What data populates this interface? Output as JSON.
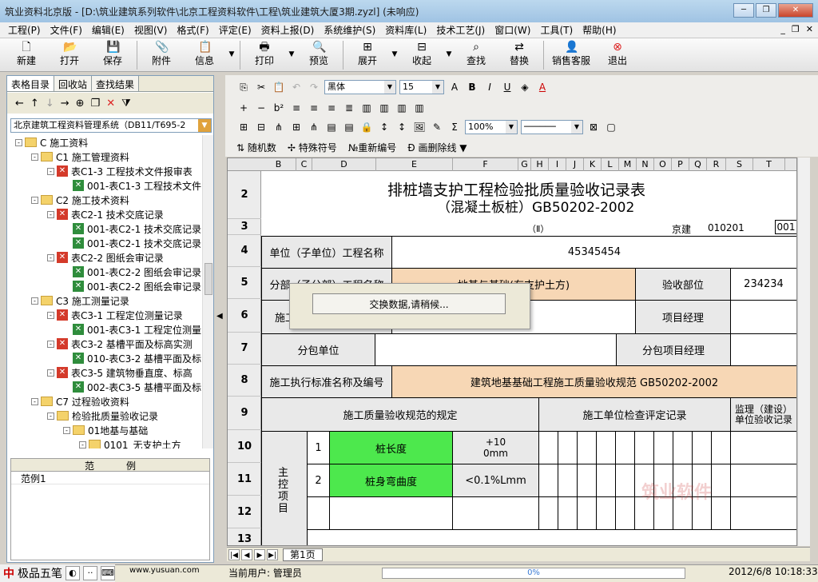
{
  "window": {
    "title": "筑业资料北京版 - [D:\\筑业建筑系列软件\\北京工程资料软件\\工程\\筑业建筑大厦3期.zyzl] (未响应)",
    "minimize": "─",
    "restore": "❐",
    "close": "✕"
  },
  "menu": [
    "工程(P)",
    "文件(F)",
    "编辑(E)",
    "视图(V)",
    "格式(F)",
    "评定(E)",
    "资料上报(D)",
    "系统维护(S)",
    "资料库(L)",
    "技术工艺(J)",
    "窗口(W)",
    "工具(T)",
    "帮助(H)"
  ],
  "menu_right": [
    "_",
    "❐",
    "✕"
  ],
  "toolbar": [
    "新建",
    "打开",
    "保存",
    "附件",
    "信息",
    "打印",
    "预览",
    "展开",
    "收起",
    "查找",
    "替换",
    "销售客服",
    "退出"
  ],
  "left": {
    "tabs": [
      "表格目录",
      "回收站",
      "查找结果"
    ],
    "system_combo": "北京建筑工程资料管理系统（DB11/T695-2",
    "tree": [
      {
        "level": 0,
        "icon": "folder",
        "toggle": "-",
        "label": "C 施工资料"
      },
      {
        "level": 1,
        "icon": "folder",
        "toggle": "-",
        "label": "C1 施工管理资料"
      },
      {
        "level": 2,
        "icon": "redx",
        "toggle": "-",
        "label": "表C1-3 工程技术文件报审表"
      },
      {
        "level": 3,
        "icon": "grnx",
        "toggle": "",
        "label": "001-表C1-3 工程技术文件"
      },
      {
        "level": 1,
        "icon": "folder",
        "toggle": "-",
        "label": "C2 施工技术资料"
      },
      {
        "level": 2,
        "icon": "redx",
        "toggle": "-",
        "label": "表C2-1 技术交底记录"
      },
      {
        "level": 3,
        "icon": "grnx",
        "toggle": "",
        "label": "001-表C2-1 技术交底记录"
      },
      {
        "level": 3,
        "icon": "grnx",
        "toggle": "",
        "label": "001-表C2-1 技术交底记录"
      },
      {
        "level": 2,
        "icon": "redx",
        "toggle": "-",
        "label": "表C2-2 图纸会审记录"
      },
      {
        "level": 3,
        "icon": "grnx",
        "toggle": "",
        "label": "001-表C2-2 图纸会审记录"
      },
      {
        "level": 3,
        "icon": "grnx",
        "toggle": "",
        "label": "001-表C2-2 图纸会审记录"
      },
      {
        "level": 1,
        "icon": "folder",
        "toggle": "-",
        "label": "C3 施工测量记录"
      },
      {
        "level": 2,
        "icon": "redx",
        "toggle": "-",
        "label": "表C3-1 工程定位测量记录"
      },
      {
        "level": 3,
        "icon": "grnx",
        "toggle": "",
        "label": "001-表C3-1 工程定位测量"
      },
      {
        "level": 2,
        "icon": "redx",
        "toggle": "-",
        "label": "表C3-2 基槽平面及标高实测"
      },
      {
        "level": 3,
        "icon": "grnx",
        "toggle": "",
        "label": "010-表C3-2 基槽平面及标"
      },
      {
        "level": 2,
        "icon": "redx",
        "toggle": "-",
        "label": "表C3-5 建筑物垂直度、标高"
      },
      {
        "level": 3,
        "icon": "grnx",
        "toggle": "",
        "label": "002-表C3-5 基槽平面及标"
      },
      {
        "level": 1,
        "icon": "folder",
        "toggle": "-",
        "label": "C7 过程验收资料"
      },
      {
        "level": 2,
        "icon": "folder",
        "toggle": "-",
        "label": "检验批质量验收记录"
      },
      {
        "level": 3,
        "icon": "folder",
        "toggle": "-",
        "label": "01地基与基础"
      },
      {
        "level": 4,
        "icon": "folder",
        "toggle": "-",
        "label": "0101_无支护土方"
      }
    ],
    "example_header": [
      "范",
      "例"
    ],
    "example_rows": [
      "范例1"
    ]
  },
  "format": {
    "font": "黑体",
    "size": "15",
    "zoom": "100%",
    "insert_links": [
      "随机数",
      "特殊符号",
      "重新编号",
      "画删除线"
    ]
  },
  "sheet": {
    "columns": [
      "B",
      "C",
      "D",
      "E",
      "F",
      "G",
      "H",
      "I",
      "J",
      "K",
      "L",
      "M",
      "N",
      "O",
      "P",
      "Q",
      "R",
      "S",
      "T"
    ],
    "rows": [
      "2",
      "3",
      "4",
      "5",
      "6",
      "7",
      "8",
      "9",
      "10",
      "11",
      "12",
      "13"
    ],
    "title_line1": "排桩墙支护工程检验批质量验收记录表",
    "title_line2": "（混凝土板桩）GB50202-2002",
    "roman": "（Ⅱ）",
    "jingjian": "京建",
    "code": "010201",
    "serial": "001",
    "unit_project_label": "单位（子单位）工程名称",
    "unit_project_value": "45345454",
    "subdivision_label": "分部（子分部）工程名称",
    "subdivision_value": "地基与基础(有支护土方)",
    "acceptance_part_label": "验收部位",
    "acceptance_part_value": "234234",
    "construction_unit_label": "施工单位",
    "project_manager_label": "项目经理",
    "subcontract_unit_label": "分包单位",
    "subcontract_pm_label": "分包项目经理",
    "standard_label": "施工执行标准名称及编号",
    "standard_value": "建筑地基基础工程施工质量验收规范  GB50202-2002",
    "spec_header": "施工质量验收规范的规定",
    "check_header": "施工单位检查评定记录",
    "supervisor_header": "监理（建设）单位验收记录",
    "main_items_label": "主控项目",
    "items": [
      {
        "no": "1",
        "name": "桩长度",
        "req": "+10\n0mm"
      },
      {
        "no": "2",
        "name": "桩身弯曲度",
        "req": "<0.1%Lmm"
      }
    ],
    "dialog_text": "交换数据,请稍候...",
    "watermark": "筑业软件",
    "sheet_tab": "第1页"
  },
  "status": {
    "ime": "极品五笔",
    "website": "www.yusuan.com",
    "user": "当前用户: 管理员",
    "progress": "0%",
    "datetime": "2012/6/8  10:18:33"
  }
}
